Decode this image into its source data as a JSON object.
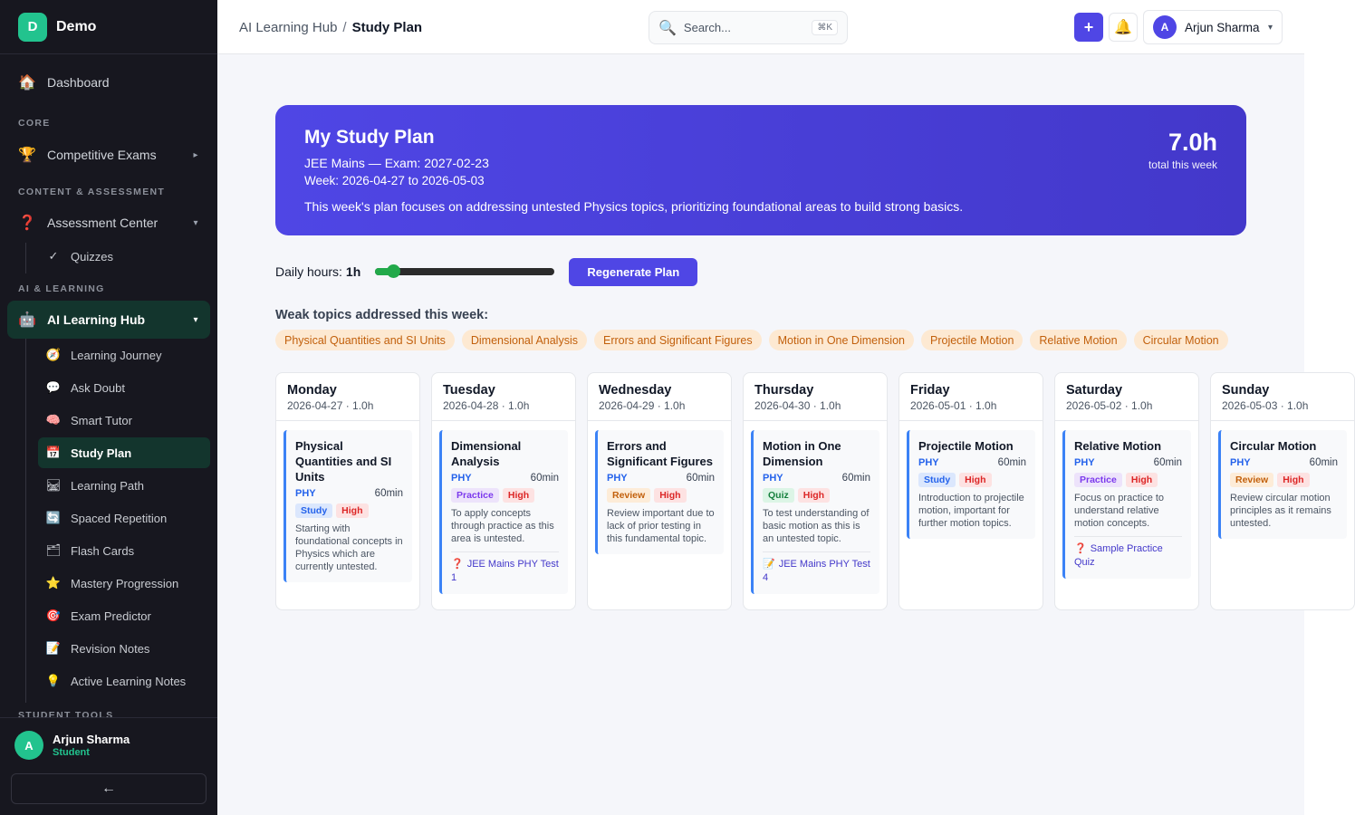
{
  "brand": {
    "logo_letter": "D",
    "name": "Demo"
  },
  "sidebar": {
    "dashboard": {
      "icon": "🏠",
      "label": "Dashboard"
    },
    "sections": {
      "core": "CORE",
      "content": "CONTENT & ASSESSMENT",
      "ai": "AI & LEARNING",
      "student": "STUDENT TOOLS"
    },
    "competitive_exams": {
      "icon": "🏆",
      "label": "Competitive Exams",
      "arrow": "▸"
    },
    "assessment_center": {
      "icon": "❓",
      "label": "Assessment Center",
      "arrow": "▾"
    },
    "quizzes": {
      "icon": "✓",
      "label": "Quizzes"
    },
    "ai_learning_hub": {
      "icon": "🤖",
      "label": "AI Learning Hub",
      "arrow": "▾"
    },
    "sub_items": [
      {
        "icon": "🧭",
        "label": "Learning Journey"
      },
      {
        "icon": "💬",
        "label": "Ask Doubt"
      },
      {
        "icon": "🧠",
        "label": "Smart Tutor"
      },
      {
        "icon": "📅",
        "label": "Study Plan"
      },
      {
        "icon": "🛤",
        "label": "Learning Path"
      },
      {
        "icon": "🔄",
        "label": "Spaced Repetition"
      },
      {
        "icon": "🗂",
        "label": "Flash Cards"
      },
      {
        "icon": "⭐",
        "label": "Mastery Progression"
      },
      {
        "icon": "🎯",
        "label": "Exam Predictor"
      },
      {
        "icon": "📝",
        "label": "Revision Notes"
      },
      {
        "icon": "💡",
        "label": "Active Learning Notes"
      }
    ],
    "user": {
      "initial": "A",
      "name": "Arjun Sharma",
      "role": "Student"
    },
    "collapse_icon": "←"
  },
  "topbar": {
    "breadcrumb_parent": "AI Learning Hub",
    "breadcrumb_sep": "/",
    "breadcrumb_current": "Study Plan",
    "search_icon": "🔍",
    "search_placeholder": "Search...",
    "search_shortcut": "⌘K",
    "add_icon": "+",
    "bell_icon": "🔔",
    "user_initial": "A",
    "user_name": "Arjun Sharma",
    "user_caret": "▾"
  },
  "hero": {
    "title": "My Study Plan",
    "exam_line": "JEE Mains — Exam: 2027-02-23",
    "week_line": "Week: 2026-04-27 to 2026-05-03",
    "description": "This week's plan focuses on addressing untested Physics topics, prioritizing foundational areas to build strong basics.",
    "total_value": "7.0h",
    "total_label": "total this week"
  },
  "controls": {
    "daily_label": "Daily hours:",
    "daily_value": "1h",
    "slider_fraction": 0.1,
    "regenerate_label": "Regenerate Plan"
  },
  "weak_topics": {
    "title": "Weak topics addressed this week:",
    "items": [
      "Physical Quantities and SI Units",
      "Dimensional Analysis",
      "Errors and Significant Figures",
      "Motion in One Dimension",
      "Projectile Motion",
      "Relative Motion",
      "Circular Motion"
    ]
  },
  "days": [
    {
      "name": "Monday",
      "meta": "2026-04-27 · 1.0h",
      "task": {
        "title": "Physical Quantities and SI Units",
        "subject": "PHY",
        "minutes": "60min",
        "type": "Study",
        "priority": "High",
        "desc": "Starting with foundational concepts in Physics which are currently untested.",
        "link_icon": "",
        "link": ""
      }
    },
    {
      "name": "Tuesday",
      "meta": "2026-04-28 · 1.0h",
      "task": {
        "title": "Dimensional Analysis",
        "subject": "PHY",
        "minutes": "60min",
        "type": "Practice",
        "priority": "High",
        "desc": "To apply concepts through practice as this area is untested.",
        "link_icon": "❓",
        "link": "JEE Mains PHY Test 1"
      }
    },
    {
      "name": "Wednesday",
      "meta": "2026-04-29 · 1.0h",
      "task": {
        "title": "Errors and Significant Figures",
        "subject": "PHY",
        "minutes": "60min",
        "type": "Review",
        "priority": "High",
        "desc": "Review important due to lack of prior testing in this fundamental topic.",
        "link_icon": "",
        "link": ""
      }
    },
    {
      "name": "Thursday",
      "meta": "2026-04-30 · 1.0h",
      "task": {
        "title": "Motion in One Dimension",
        "subject": "PHY",
        "minutes": "60min",
        "type": "Quiz",
        "priority": "High",
        "desc": "To test understanding of basic motion as this is an untested topic.",
        "link_icon": "📝",
        "link": "JEE Mains PHY Test 4"
      }
    },
    {
      "name": "Friday",
      "meta": "2026-05-01 · 1.0h",
      "task": {
        "title": "Projectile Motion",
        "subject": "PHY",
        "minutes": "60min",
        "type": "Study",
        "priority": "High",
        "desc": "Introduction to projectile motion, important for further motion topics.",
        "link_icon": "",
        "link": ""
      }
    },
    {
      "name": "Saturday",
      "meta": "2026-05-02 · 1.0h",
      "task": {
        "title": "Relative Motion",
        "subject": "PHY",
        "minutes": "60min",
        "type": "Practice",
        "priority": "High",
        "desc": "Focus on practice to understand relative motion concepts.",
        "link_icon": "❓",
        "link": "Sample Practice Quiz"
      }
    },
    {
      "name": "Sunday",
      "meta": "2026-05-03 · 1.0h",
      "task": {
        "title": "Circular Motion",
        "subject": "PHY",
        "minutes": "60min",
        "type": "Review",
        "priority": "High",
        "desc": "Review circular motion principles as it remains untested.",
        "link_icon": "",
        "link": ""
      }
    }
  ],
  "colors": {
    "accent": "#4f46e5",
    "brand_green": "#22c38e",
    "sidebar_bg": "#17171f",
    "chip_bg": "#fde9d2",
    "chip_text": "#c2600c"
  }
}
